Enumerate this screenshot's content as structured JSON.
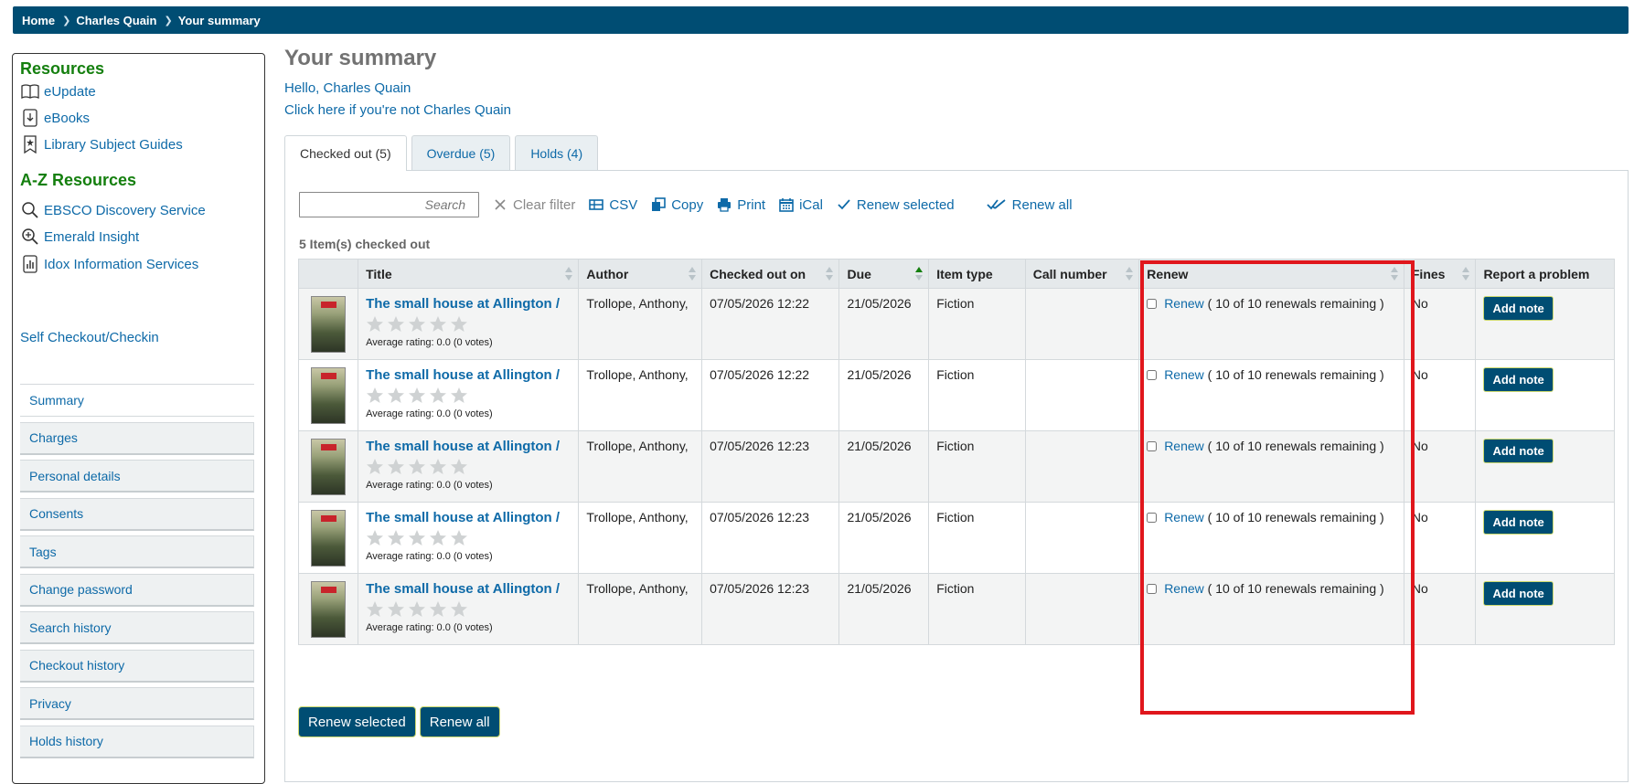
{
  "breadcrumb": [
    {
      "label": "Home"
    },
    {
      "label": "Charles Quain"
    },
    {
      "label": "Your summary"
    }
  ],
  "sidebar": {
    "resources_heading": "Resources",
    "resources": [
      {
        "label": "eUpdate",
        "icon": "book-open-icon"
      },
      {
        "label": "eBooks",
        "icon": "download-file-icon"
      },
      {
        "label": "Library Subject Guides",
        "icon": "bookmark-star-icon"
      }
    ],
    "az_heading": "A-Z Resources",
    "az": [
      {
        "label": "EBSCO Discovery Service",
        "icon": "magnifier-icon"
      },
      {
        "label": "Emerald Insight",
        "icon": "zoom-in-icon"
      },
      {
        "label": "Idox Information Services",
        "icon": "chart-file-icon"
      }
    ],
    "self_checkout": "Self Checkout/Checkin",
    "menu": [
      {
        "label": "Summary",
        "active": true
      },
      {
        "label": "Charges"
      },
      {
        "label": "Personal details"
      },
      {
        "label": "Consents"
      },
      {
        "label": "Tags"
      },
      {
        "label": "Change password"
      },
      {
        "label": "Search history"
      },
      {
        "label": "Checkout history"
      },
      {
        "label": "Privacy"
      },
      {
        "label": "Holds history"
      }
    ]
  },
  "main": {
    "title": "Your summary",
    "hello": "Hello, Charles Quain",
    "not_me": "Click here if you're not Charles Quain",
    "tabs": [
      {
        "label": "Checked out (5)",
        "active": true
      },
      {
        "label": "Overdue (5)"
      },
      {
        "label": "Holds (4)"
      }
    ],
    "toolbar": {
      "search_placeholder": "Search",
      "clear_filter": "Clear filter",
      "csv": "CSV",
      "copy": "Copy",
      "print": "Print",
      "ical": "iCal",
      "renew_selected": "Renew selected",
      "renew_all": "Renew all"
    },
    "count_label": "5 Item(s) checked out",
    "columns": [
      "Title",
      "Author",
      "Checked out on",
      "Due",
      "Item type",
      "Call number",
      "Renew",
      "Fines",
      "Report a problem"
    ],
    "rows": [
      {
        "title": "The small house at Allington /",
        "rating": "Average rating: 0.0 (0 votes)",
        "author": "Trollope, Anthony,",
        "checked_out": "07/05/2026 12:22",
        "due": "21/05/2026",
        "item_type": "Fiction",
        "call_number": "",
        "renew_link": "Renew",
        "renew_info": "( 10 of 10 renewals remaining )",
        "fines": "No",
        "note_button": "Add note"
      },
      {
        "title": "The small house at Allington /",
        "rating": "Average rating: 0.0 (0 votes)",
        "author": "Trollope, Anthony,",
        "checked_out": "07/05/2026 12:22",
        "due": "21/05/2026",
        "item_type": "Fiction",
        "call_number": "",
        "renew_link": "Renew",
        "renew_info": "( 10 of 10 renewals remaining )",
        "fines": "No",
        "note_button": "Add note"
      },
      {
        "title": "The small house at Allington /",
        "rating": "Average rating: 0.0 (0 votes)",
        "author": "Trollope, Anthony,",
        "checked_out": "07/05/2026 12:23",
        "due": "21/05/2026",
        "item_type": "Fiction",
        "call_number": "",
        "renew_link": "Renew",
        "renew_info": "( 10 of 10 renewals remaining )",
        "fines": "No",
        "note_button": "Add note"
      },
      {
        "title": "The small house at Allington /",
        "rating": "Average rating: 0.0 (0 votes)",
        "author": "Trollope, Anthony,",
        "checked_out": "07/05/2026 12:23",
        "due": "21/05/2026",
        "item_type": "Fiction",
        "call_number": "",
        "renew_link": "Renew",
        "renew_info": "( 10 of 10 renewals remaining )",
        "fines": "No",
        "note_button": "Add note"
      },
      {
        "title": "The small house at Allington /",
        "rating": "Average rating: 0.0 (0 votes)",
        "author": "Trollope, Anthony,",
        "checked_out": "07/05/2026 12:23",
        "due": "21/05/2026",
        "item_type": "Fiction",
        "call_number": "",
        "renew_link": "Renew",
        "renew_info": "( 10 of 10 renewals remaining )",
        "fines": "No",
        "note_button": "Add note"
      }
    ],
    "bottom_buttons": {
      "renew_selected": "Renew selected",
      "renew_all": "Renew all"
    }
  },
  "colors": {
    "brand": "#004d73",
    "link": "#0e6aa8",
    "heading_green": "#147f0e",
    "due_red": "#c8242b",
    "highlight": "#e0161c"
  }
}
